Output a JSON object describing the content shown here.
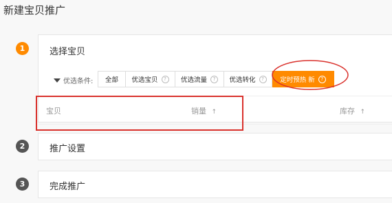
{
  "page": {
    "title": "新建宝贝推广"
  },
  "steps": [
    {
      "number": "1",
      "title": "选择宝贝",
      "state": "active"
    },
    {
      "number": "2",
      "title": "推广设置",
      "state": "inactive"
    },
    {
      "number": "3",
      "title": "完成推广",
      "state": "inactive"
    }
  ],
  "filter": {
    "label": "优选条件:",
    "icon": "funnel-icon",
    "tabs": [
      {
        "label": "全部",
        "help": ""
      },
      {
        "label": "优选宝贝",
        "help": "?"
      },
      {
        "label": "优选流量",
        "help": "?"
      },
      {
        "label": "优选转化",
        "help": "?"
      },
      {
        "label": "定时预热 新",
        "help": "?"
      }
    ],
    "selected": "定时预热 新"
  },
  "table": {
    "columns": [
      {
        "label": "宝贝",
        "sort": ""
      },
      {
        "label": "销量",
        "sort": "↑"
      },
      {
        "label": "库存",
        "sort": "↑"
      }
    ]
  },
  "colors": {
    "accent": "#ff8a00",
    "annotation": "#d9302b"
  }
}
